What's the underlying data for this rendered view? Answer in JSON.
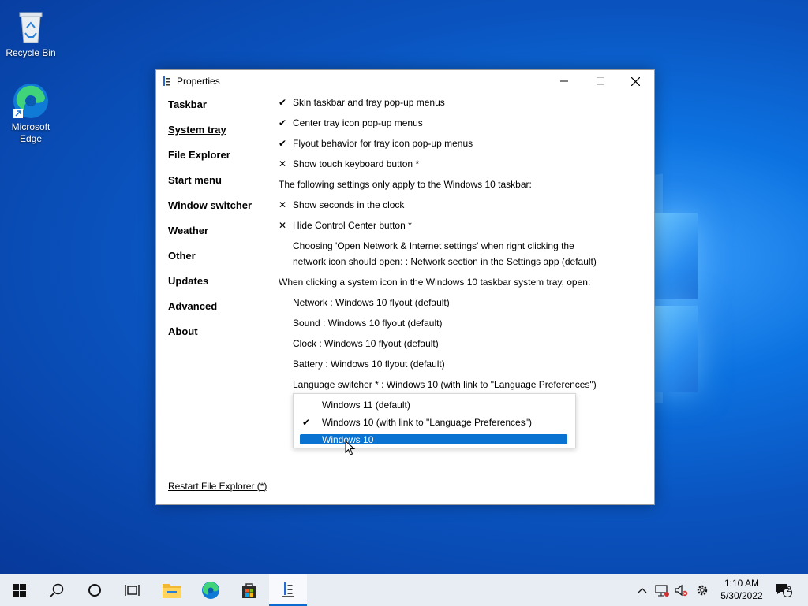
{
  "desktop": {
    "icons": [
      {
        "label": "Recycle Bin",
        "icon": "recycle-bin-icon"
      },
      {
        "label": "Microsoft Edge",
        "icon": "edge-icon"
      }
    ]
  },
  "window": {
    "title": "Properties",
    "controls": {
      "minimize": "minimize-icon",
      "maximize": "maximize-icon",
      "close": "close-icon"
    },
    "nav": [
      {
        "label": "Taskbar"
      },
      {
        "label": "System tray",
        "selected": true
      },
      {
        "label": "File Explorer"
      },
      {
        "label": "Start menu"
      },
      {
        "label": "Window switcher"
      },
      {
        "label": "Weather"
      },
      {
        "label": "Other"
      },
      {
        "label": "Updates"
      },
      {
        "label": "Advanced"
      },
      {
        "label": "About"
      }
    ],
    "settings": {
      "skin_menus": {
        "mark": "✔",
        "label": "Skin taskbar and tray pop-up menus"
      },
      "center_menus": {
        "mark": "✔",
        "label": "Center tray icon pop-up menus"
      },
      "flyout_menus": {
        "mark": "✔",
        "label": "Flyout behavior for tray icon pop-up menus"
      },
      "touch_keyboard": {
        "mark": "✕",
        "label": "Show touch keyboard button *"
      },
      "win10_note": "The following settings only apply to the Windows 10 taskbar:",
      "show_seconds": {
        "mark": "✕",
        "label": "Show seconds in the clock"
      },
      "hide_control_center": {
        "mark": "✕",
        "label": "Hide Control Center button *"
      },
      "network_choice_line1": "Choosing 'Open Network & Internet settings' when right clicking the",
      "network_choice_line2": "network icon should open: : Network section in the Settings app (default)",
      "system_icon_note": "When clicking a system icon in the Windows 10 taskbar system tray, open:",
      "network": "Network : Windows 10 flyout (default)",
      "sound": "Sound : Windows 10 flyout (default)",
      "clock": "Clock : Windows 10 flyout (default)",
      "battery": "Battery : Windows 10 flyout (default)",
      "language_switcher": "Language switcher * : Windows 10 (with link to \"Language Preferences\")"
    },
    "dropdown": {
      "options": [
        {
          "label": "Windows 11 (default)",
          "checked": false,
          "highlighted": false
        },
        {
          "label": "Windows 10 (with link to \"Language Preferences\")",
          "checked": true,
          "highlighted": false
        },
        {
          "label": "Windows 10",
          "checked": false,
          "highlighted": true
        }
      ],
      "check_glyph": "✔"
    },
    "restart_link": "Restart File Explorer (*)"
  },
  "taskbar": {
    "pinned": [
      "windows-start-icon",
      "search-icon",
      "cortana-icon",
      "task-view-icon",
      "file-explorer-icon",
      "edge-icon",
      "store-icon",
      "properties-app-icon"
    ],
    "tray": [
      "chevron-up-icon",
      "network-icon",
      "volume-muted-icon",
      "gear-icon"
    ],
    "time": "1:10 AM",
    "date": "5/30/2022",
    "notification_count": "2"
  },
  "colors": {
    "accent": "#0a73d1",
    "desktop": "#0c72e0",
    "taskbar": "#e8edf4"
  }
}
